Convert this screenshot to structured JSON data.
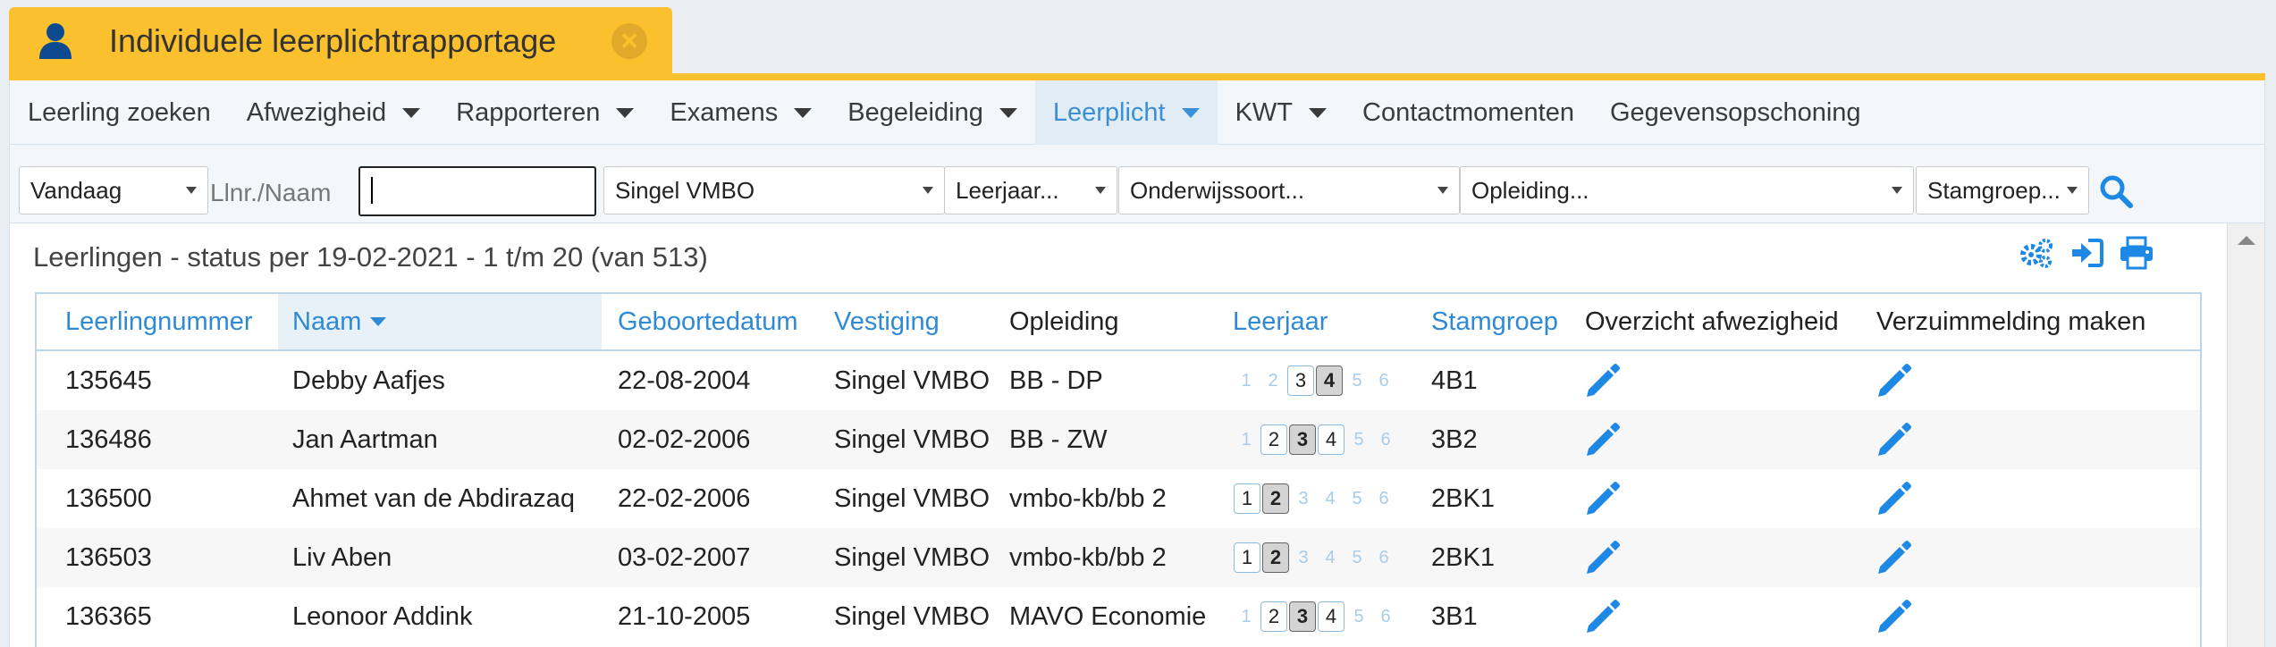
{
  "window": {
    "title": "Individuele leerplichtrapportage"
  },
  "nav": {
    "items": [
      {
        "label": "Leerling zoeken",
        "dropdown": false,
        "active": false
      },
      {
        "label": "Afwezigheid",
        "dropdown": true,
        "active": false
      },
      {
        "label": "Rapporteren",
        "dropdown": true,
        "active": false
      },
      {
        "label": "Examens",
        "dropdown": true,
        "active": false
      },
      {
        "label": "Begeleiding",
        "dropdown": true,
        "active": false
      },
      {
        "label": "Leerplicht",
        "dropdown": true,
        "active": true
      },
      {
        "label": "KWT",
        "dropdown": true,
        "active": false
      },
      {
        "label": "Contactmomenten",
        "dropdown": false,
        "active": false
      },
      {
        "label": "Gegevensopschoning",
        "dropdown": false,
        "active": false
      }
    ]
  },
  "filters": {
    "period": "Vandaag",
    "search_label": "Llnr./Naam",
    "search_value": "",
    "location": "Singel VMBO",
    "leerjaar": "Leerjaar...",
    "onderwijssoort": "Onderwijssoort...",
    "opleiding": "Opleiding...",
    "stamgroep": "Stamgroep..."
  },
  "content": {
    "heading": "Leerlingen - status per 19-02-2021 - 1 t/m 20 (van 513)"
  },
  "table": {
    "columns": [
      "Leerlingnummer",
      "Naam",
      "Geboortedatum",
      "Vestiging",
      "Opleiding",
      "Leerjaar",
      "Stamgroep",
      "Overzicht afwezigheid",
      "Verzuimmelding maken"
    ],
    "rows": [
      {
        "nummer": "135645",
        "naam": "Debby Aafjes",
        "geboortedatum": "22-08-2004",
        "vestiging": "Singel VMBO",
        "opleiding": "BB - DP",
        "leerjaar_current": 4,
        "stamgroep": "4B1"
      },
      {
        "nummer": "136486",
        "naam": "Jan Aartman",
        "geboortedatum": "02-02-2006",
        "vestiging": "Singel VMBO",
        "opleiding": "BB - ZW",
        "leerjaar_current": 3,
        "stamgroep": "3B2"
      },
      {
        "nummer": "136500",
        "naam": "Ahmet van de Abdirazaq",
        "geboortedatum": "22-02-2006",
        "vestiging": "Singel VMBO",
        "opleiding": "vmbo-kb/bb 2",
        "leerjaar_current": 2,
        "stamgroep": "2BK1"
      },
      {
        "nummer": "136503",
        "naam": "Liv Aben",
        "geboortedatum": "03-02-2007",
        "vestiging": "Singel VMBO",
        "opleiding": "vmbo-kb/bb 2",
        "leerjaar_current": 2,
        "stamgroep": "2BK1"
      },
      {
        "nummer": "136365",
        "naam": "Leonoor Addink",
        "geboortedatum": "21-10-2005",
        "vestiging": "Singel VMBO",
        "opleiding": "MAVO Economie",
        "leerjaar_current": 3,
        "stamgroep": "3B1"
      }
    ]
  },
  "colors": {
    "accent": "#2f8ad6",
    "brand": "#fbc02d",
    "icon_blue": "#1e88e5"
  },
  "icons": {
    "user": "user-icon",
    "close": "close-icon",
    "search": "search-icon",
    "settings": "gears-icon",
    "signin": "sign-in-icon",
    "print": "print-icon",
    "edit": "pencil-icon"
  }
}
